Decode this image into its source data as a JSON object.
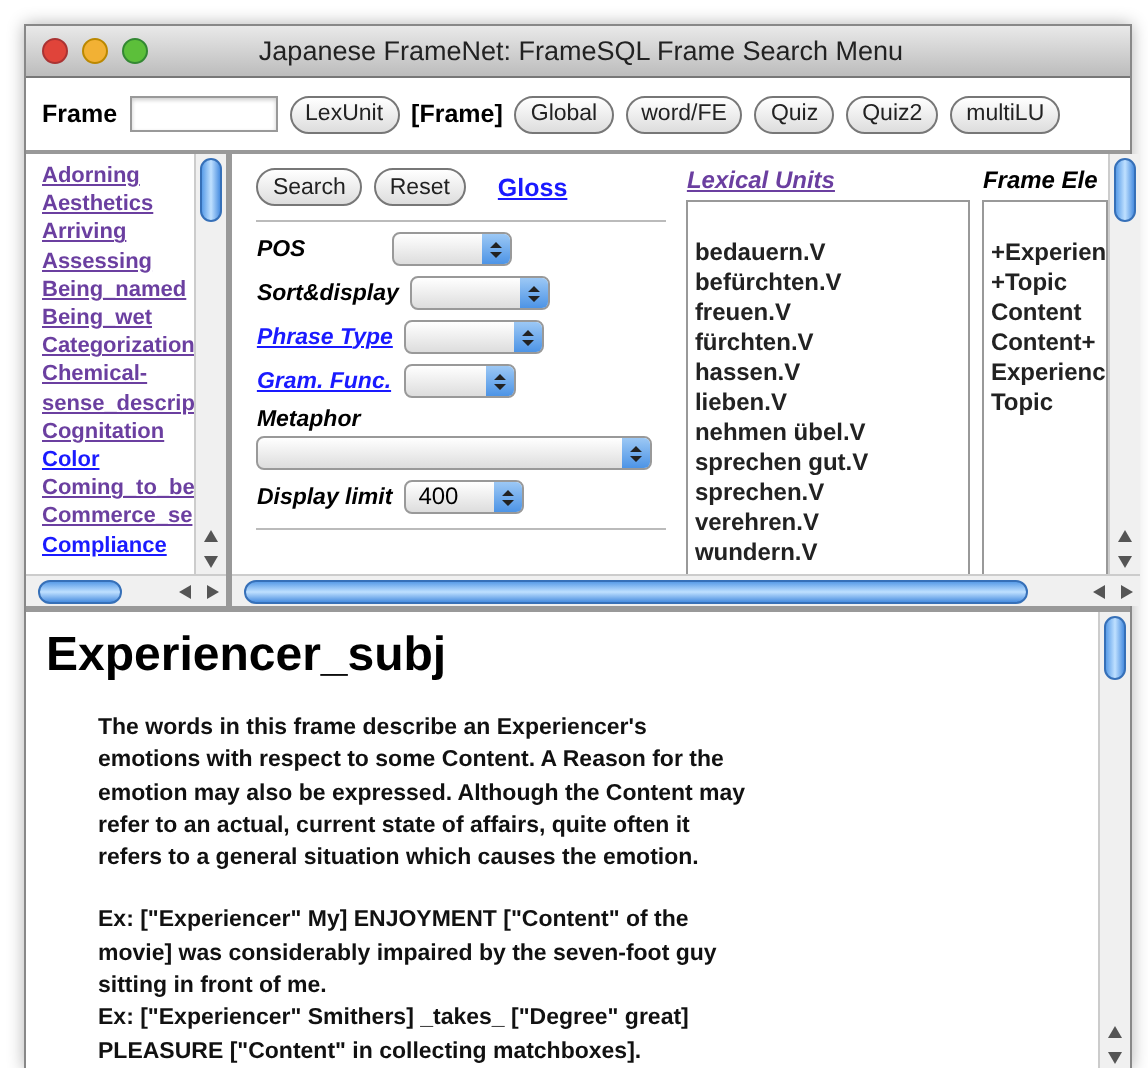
{
  "window": {
    "title": "Japanese FrameNet: FrameSQL Frame Search Menu"
  },
  "toolbar": {
    "frame_label": "Frame",
    "mode_label": "[Frame]",
    "buttons": [
      {
        "label": "LexUnit",
        "kind": "button"
      },
      {
        "label": "Global",
        "kind": "button"
      },
      {
        "label": "word/FE",
        "kind": "button"
      },
      {
        "label": "Quiz",
        "kind": "button"
      },
      {
        "label": "Quiz2",
        "kind": "button"
      },
      {
        "label": "multiLU",
        "kind": "button"
      }
    ]
  },
  "frame_list": [
    {
      "name": "Adorning",
      "visited": true
    },
    {
      "name": "Aesthetics",
      "visited": true
    },
    {
      "name": "Arriving",
      "visited": true
    },
    {
      "name": "Assessing",
      "visited": true
    },
    {
      "name": "Being_named",
      "visited": true
    },
    {
      "name": "Being_wet",
      "visited": true
    },
    {
      "name": "Categorization",
      "visited": true
    },
    {
      "name": "Chemical-sense_descrip",
      "visited": true
    },
    {
      "name": "Cognitation",
      "visited": true
    },
    {
      "name": "Color",
      "visited": false
    },
    {
      "name": "Coming_to_be",
      "visited": true
    },
    {
      "name": "Commerce_se",
      "visited": true
    },
    {
      "name": "Compliance",
      "visited": false
    }
  ],
  "search_form": {
    "buttons": [
      "Search",
      "Reset"
    ],
    "gloss_link": "Gloss",
    "fields": [
      {
        "label": "POS",
        "link": false,
        "kind": "inline"
      },
      {
        "label": "Sort&display",
        "link": false,
        "kind": "inline"
      },
      {
        "label": "Phrase Type",
        "link": true,
        "kind": "inline"
      },
      {
        "label": "Gram. Func.",
        "link": true,
        "kind": "inline"
      },
      {
        "label": "Metaphor",
        "link": false,
        "kind": "stacked"
      },
      {
        "label": "Display limit",
        "link": false,
        "kind": "inline",
        "value": "400"
      }
    ]
  },
  "lexical_units": {
    "title": "Lexical Units",
    "items": [
      "bedauern.V",
      "befürchten.V",
      "freuen.V",
      "fürchten.V",
      "hassen.V",
      "lieben.V",
      "nehmen übel.V",
      "sprechen gut.V",
      "sprechen.V",
      "verehren.V",
      "wundern.V"
    ]
  },
  "frame_elements": {
    "title": "Frame Ele",
    "items": [
      "+Experien",
      "+Topic",
      "Content",
      "Content+",
      "Experienc",
      "Topic"
    ]
  },
  "document": {
    "heading": "Experiencer_subj",
    "paragraphs": [
      "The words in this frame describe an Experiencer's emotions with respect to some Content. A Reason for the emotion may also be expressed. Although the Content may refer to an actual, current state of affairs, quite often it refers to a general situation which causes the emotion."
    ],
    "examples": [
      "Ex: [\"Experiencer\" My] ENJOYMENT [\"Content\" of the movie] was considerably impaired by the seven-foot guy sitting in front of me.",
      "Ex: [\"Experiencer\" Smithers] _takes_ [\"Degree\" great] PLEASURE [\"Content\" in collecting matchboxes]."
    ]
  }
}
